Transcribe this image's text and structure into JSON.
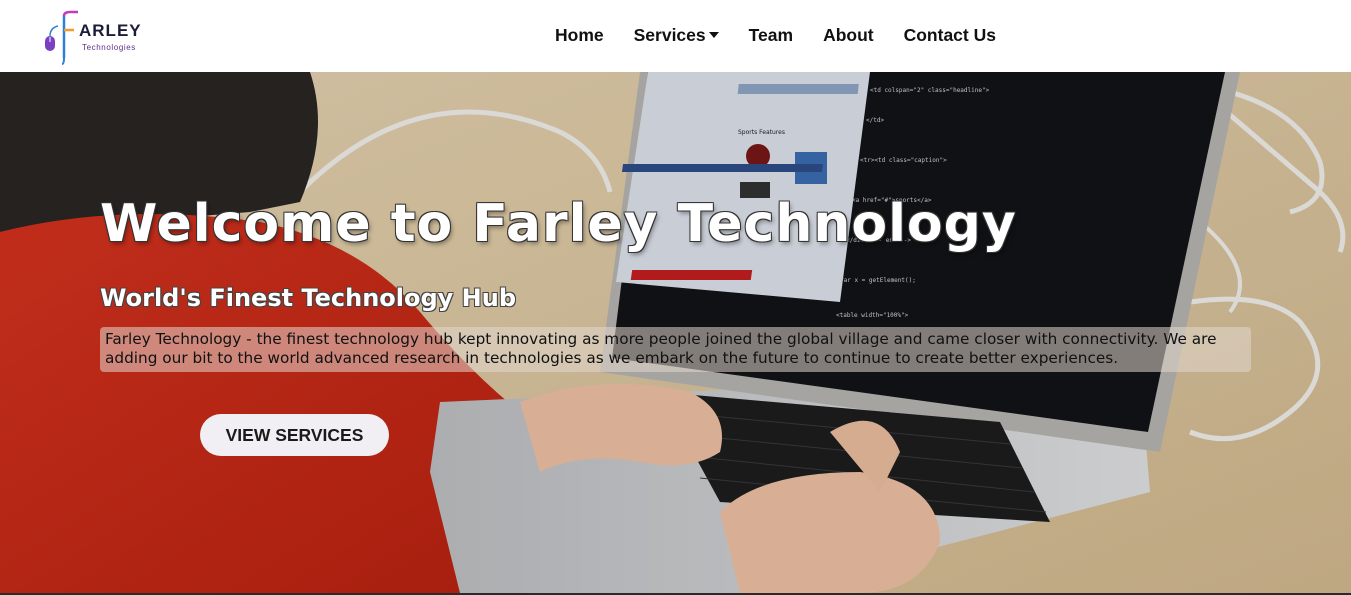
{
  "brand": {
    "name": "ARLEY",
    "subtitle": "Technologies",
    "logo_letter": "F",
    "colors": {
      "purple": "#6a2fa8",
      "blue": "#2f7fd6",
      "magenta": "#c23bb8"
    }
  },
  "nav": {
    "items": [
      {
        "label": "Home"
      },
      {
        "label": "Services",
        "has_dropdown": true
      },
      {
        "label": "Team"
      },
      {
        "label": "About"
      },
      {
        "label": "Contact Us"
      }
    ]
  },
  "hero": {
    "title": "Welcome to Farley Technology",
    "subtitle": "World's Finest Technology Hub",
    "description": "Farley Technology - the finest technology hub kept innovating as more people joined the global village and came closer with connectivity. We are adding our bit to the world advanced research in technologies as we embark on the future to continue to create better experiences.",
    "cta_label": "VIEW SERVICES",
    "background_image": "person-typing-on-laptop",
    "laptop_screen": {
      "page_heading": "Sports Features",
      "code_lines": [
        "<td colspan=\"2\" class=\"headline\">",
        "</td>",
        "<tr><td class=\"caption\">",
        "<a href=\"#\">sports</a>",
        "</div><!-- end -->",
        "var x = getElement();",
        "<table width=\"100%\">"
      ]
    }
  }
}
